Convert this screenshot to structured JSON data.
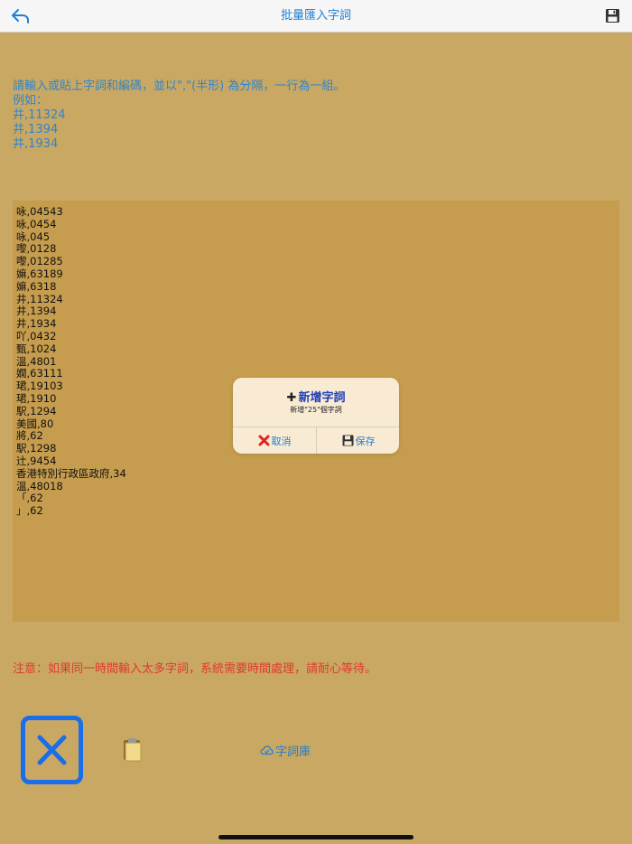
{
  "header": {
    "title": "批量匯入字詞",
    "back_icon": "undo-arrow-icon",
    "save_icon": "floppy-disk-icon"
  },
  "instructions": {
    "line1": "請輸入或貼上字詞和編碼，並以\",\"(半形) 為分隔，一行為一組。",
    "line2": "例如：",
    "line3": "井,11324",
    "line4": "井,1394",
    "line5": "井,1934"
  },
  "editor": {
    "lines": [
      "咏,04543",
      "咏,0454",
      "咏,045",
      "嚟,0128",
      "嚟,01285",
      "嫲,63189",
      "嫲,6318",
      "井,11324",
      "井,1394",
      "井,1934",
      "吖,0432",
      "甄,1024",
      "溫,4801",
      "嫺,63111",
      "珺,19103",
      "珺,1910",
      "駅,1294",
      "美國,80",
      "將,62",
      "駅,1298",
      "辻,9454",
      "香港特別行政區政府,34",
      "溫,48018",
      "「,62",
      "」,62"
    ]
  },
  "notice": "注意：如果同一時間輸入太多字詞，系統需要時間處理，請耐心等待。",
  "bottom": {
    "close_icon": "close-x-icon",
    "paste_icon": "clipboard-icon",
    "dict_label": "字詞庫",
    "dict_icon": "cloud-icon"
  },
  "dialog": {
    "title": "新增字詞",
    "message": "新增\"25\"個字詞",
    "cancel_label": "取消",
    "save_label": "保存"
  },
  "colors": {
    "background": "#c9a863",
    "editor": "#c69d4e",
    "accent": "#1e7fd2",
    "warning": "#e0392e",
    "dialog": "#f9ebd3"
  }
}
